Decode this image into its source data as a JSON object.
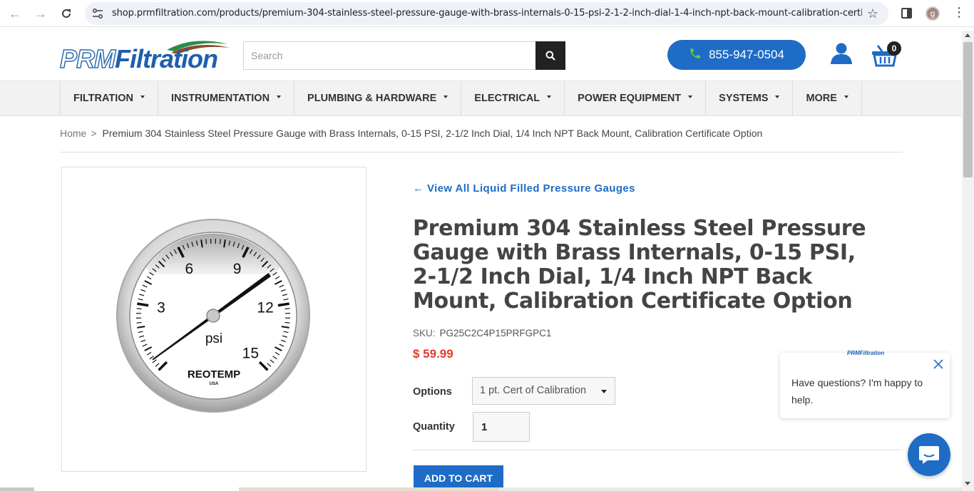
{
  "browser": {
    "url": "shop.prmfiltration.com/products/premium-304-stainless-steel-pressure-gauge-with-brass-internals-0-15-psi-2-1-2-inch-dial-1-4-inch-npt-back-mount-calibration-certif...",
    "profile_initial": "g"
  },
  "header": {
    "logo_prefix": "PRM",
    "logo_suffix": "Filtration",
    "search_placeholder": "Search",
    "phone": "855-947-0504",
    "cart_count": "0"
  },
  "nav": {
    "items": [
      {
        "label": "FILTRATION"
      },
      {
        "label": "INSTRUMENTATION"
      },
      {
        "label": "PLUMBING & HARDWARE"
      },
      {
        "label": "ELECTRICAL"
      },
      {
        "label": "POWER EQUIPMENT"
      },
      {
        "label": "SYSTEMS"
      },
      {
        "label": "MORE"
      }
    ]
  },
  "breadcrumb": {
    "home": "Home",
    "separator": ">",
    "current": "Premium 304 Stainless Steel Pressure Gauge with Brass Internals, 0-15 PSI, 2-1/2 Inch Dial, 1/4 Inch NPT Back Mount, Calibration Certificate Option"
  },
  "product": {
    "back_link": "← View All Liquid Filled Pressure Gauges",
    "title": "Premium 304 Stainless Steel Pressure Gauge with Brass Internals, 0-15 PSI, 2-1/2 Inch Dial, 1/4 Inch NPT Back Mount, Calibration Certificate Option",
    "sku_label": "SKU:",
    "sku": "PG25C2C4P15PRFGPC1",
    "price": "$ 59.99",
    "options_label": "Options",
    "options_selected": "1 pt. Cert of Calibration",
    "quantity_label": "Quantity",
    "quantity": "1",
    "add_to_cart": "ADD TO CART",
    "gauge": {
      "labels": [
        "3",
        "6",
        "9",
        "12",
        "15"
      ],
      "unit": "psi",
      "brand": "REOTEMP",
      "brand_sub": "USA",
      "needle_value": 10.5
    }
  },
  "chat": {
    "logo": "PRMFiltration",
    "message": "Have questions? I'm happy to help."
  },
  "colors": {
    "accent": "#1e6cc5",
    "price": "#e03a2f",
    "phone_icon": "#5fcf3c"
  }
}
